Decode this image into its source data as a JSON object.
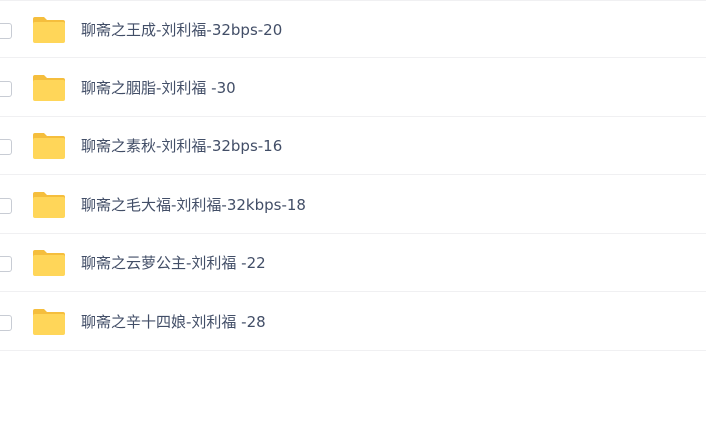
{
  "file_list": {
    "items": [
      {
        "name": "聊斋之王成-刘利福-32bps-20",
        "type": "folder",
        "icon": "folder-icon"
      },
      {
        "name": "聊斋之胭脂-刘利福 -30",
        "type": "folder",
        "icon": "folder-icon"
      },
      {
        "name": "聊斋之素秋-刘利福-32bps-16",
        "type": "folder",
        "icon": "folder-icon"
      },
      {
        "name": "聊斋之毛大福-刘利福-32kbps-18",
        "type": "folder",
        "icon": "folder-icon"
      },
      {
        "name": "聊斋之云萝公主-刘利福 -22",
        "type": "folder",
        "icon": "folder-icon"
      },
      {
        "name": "聊斋之辛十四娘-刘利福 -28",
        "type": "folder",
        "icon": "folder-icon"
      }
    ]
  },
  "colors": {
    "folder_body": "#FFD659",
    "folder_back": "#F5BE3D",
    "text": "#424E67",
    "divider": "#F0F0F2"
  }
}
